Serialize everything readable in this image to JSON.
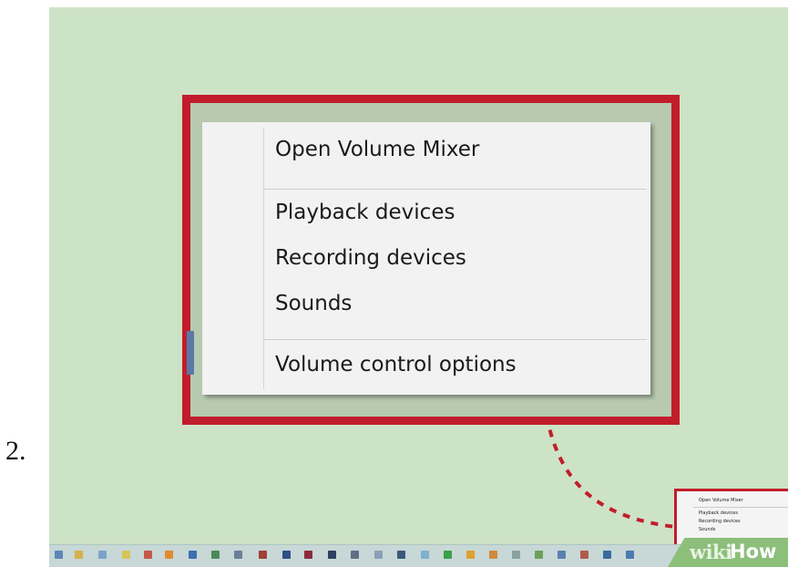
{
  "step_number": "2.",
  "context_menu": {
    "items": [
      {
        "label": "Open Volume Mixer"
      },
      {
        "label": "Playback devices"
      },
      {
        "label": "Recording devices"
      },
      {
        "label": "Sounds"
      },
      {
        "label": "Volume control options"
      }
    ]
  },
  "mini_menu": {
    "items": [
      {
        "label": "Open Volume Mixer"
      },
      {
        "label": "Playback devices"
      },
      {
        "label": "Recording devices"
      },
      {
        "label": "Sounds"
      }
    ]
  },
  "watermark": {
    "wiki": "wiki",
    "how": "How"
  },
  "colors": {
    "highlight_border": "#c11d2b",
    "background": "#cde3c6",
    "menu_background": "#f2f2f2",
    "taskbar": "#c7d8d6"
  }
}
